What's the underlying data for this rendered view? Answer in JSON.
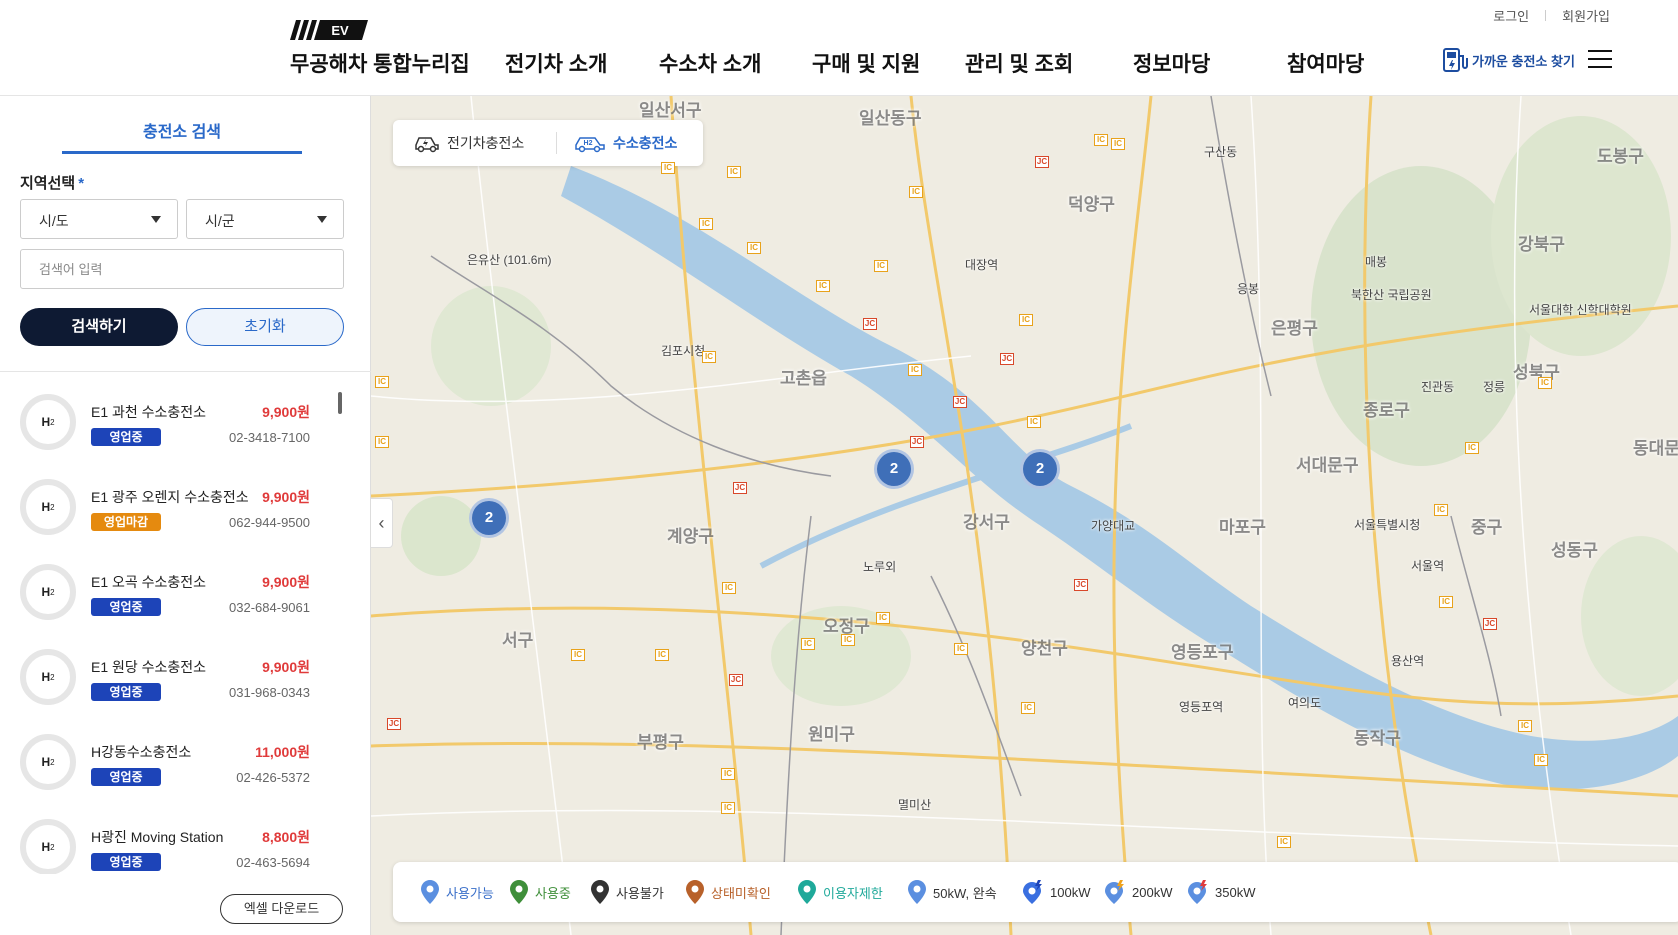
{
  "header": {
    "logo_text": "EV",
    "brand": "무공해차 통합누리집",
    "nav": [
      "전기차 소개",
      "수소차 소개",
      "구매 및 지원",
      "관리 및 조회",
      "정보마당",
      "참여마당"
    ],
    "login": "로그인",
    "signup": "회원가입",
    "near_station": "가까운 충전소 찾기"
  },
  "sidebar": {
    "tab": "충전소 검색",
    "region_label": "지역선택",
    "required_mark": "*",
    "sido": "시/도",
    "sigun": "시/군",
    "search_placeholder": "검색어 입력",
    "search_button": "검색하기",
    "reset_button": "초기화",
    "excel_button": "엑셀 다운로드",
    "stations": [
      {
        "name": "E1 과천 수소충전소",
        "price": "9,900원",
        "status": "영업중",
        "phone": "02-3418-7100",
        "status_type": "open"
      },
      {
        "name": "E1 광주 오렌지 수소충전소",
        "price": "9,900원",
        "status": "영업마감",
        "phone": "062-944-9500",
        "status_type": "closed"
      },
      {
        "name": "E1 오곡 수소충전소",
        "price": "9,900원",
        "status": "영업중",
        "phone": "032-684-9061",
        "status_type": "open"
      },
      {
        "name": "E1 원당 수소충전소",
        "price": "9,900원",
        "status": "영업중",
        "phone": "031-968-0343",
        "status_type": "open"
      },
      {
        "name": "H강동수소충전소",
        "price": "11,000원",
        "status": "영업중",
        "phone": "02-426-5372",
        "status_type": "open"
      },
      {
        "name": "H광진 Moving Station",
        "price": "8,800원",
        "status": "영업중",
        "phone": "02-463-5694",
        "status_type": "open"
      }
    ],
    "h2_label": "H",
    "h2_sub": "2"
  },
  "map": {
    "tabs": {
      "ev": "전기차충전소",
      "h2": "수소충전소"
    },
    "clusters": [
      "2",
      "2",
      "2"
    ],
    "districts": [
      "일산서구",
      "일산동구",
      "덕양구",
      "도봉구",
      "강북구",
      "은평구",
      "성북구",
      "종로구",
      "서대문구",
      "동대문구",
      "마포구",
      "중구",
      "성동구",
      "강서구",
      "양천구",
      "영등포구",
      "동작구",
      "계양구",
      "서구",
      "부평구",
      "오정구",
      "원미구",
      "고촌읍"
    ],
    "places": [
      "김포시청",
      "대장역",
      "은유산 (101.6m)",
      "북한산 국립공원",
      "서울대학 신학대학원",
      "서울특별시청",
      "노루외",
      "멸미산",
      "서울역",
      "영등포역",
      "여의도",
      "용산역",
      "가양대교",
      "진관동",
      "정릉",
      "구산동",
      "매봉",
      "응봉"
    ],
    "legend": [
      {
        "label": "사용가능",
        "color": "#5b8fe0"
      },
      {
        "label": "사용중",
        "color": "#3f8f3a"
      },
      {
        "label": "사용불가",
        "color": "#333333"
      },
      {
        "label": "상태미확인",
        "color": "#b8612a"
      },
      {
        "label": "이용자제한",
        "color": "#1fa99a"
      },
      {
        "label": "50kW, 완속",
        "color": "#5b8fe0"
      },
      {
        "label": "100kW",
        "color": "#3a6fe0"
      },
      {
        "label": "200kW",
        "color": "#5b8fe0"
      },
      {
        "label": "350kW",
        "color": "#5b8fe0"
      }
    ]
  }
}
